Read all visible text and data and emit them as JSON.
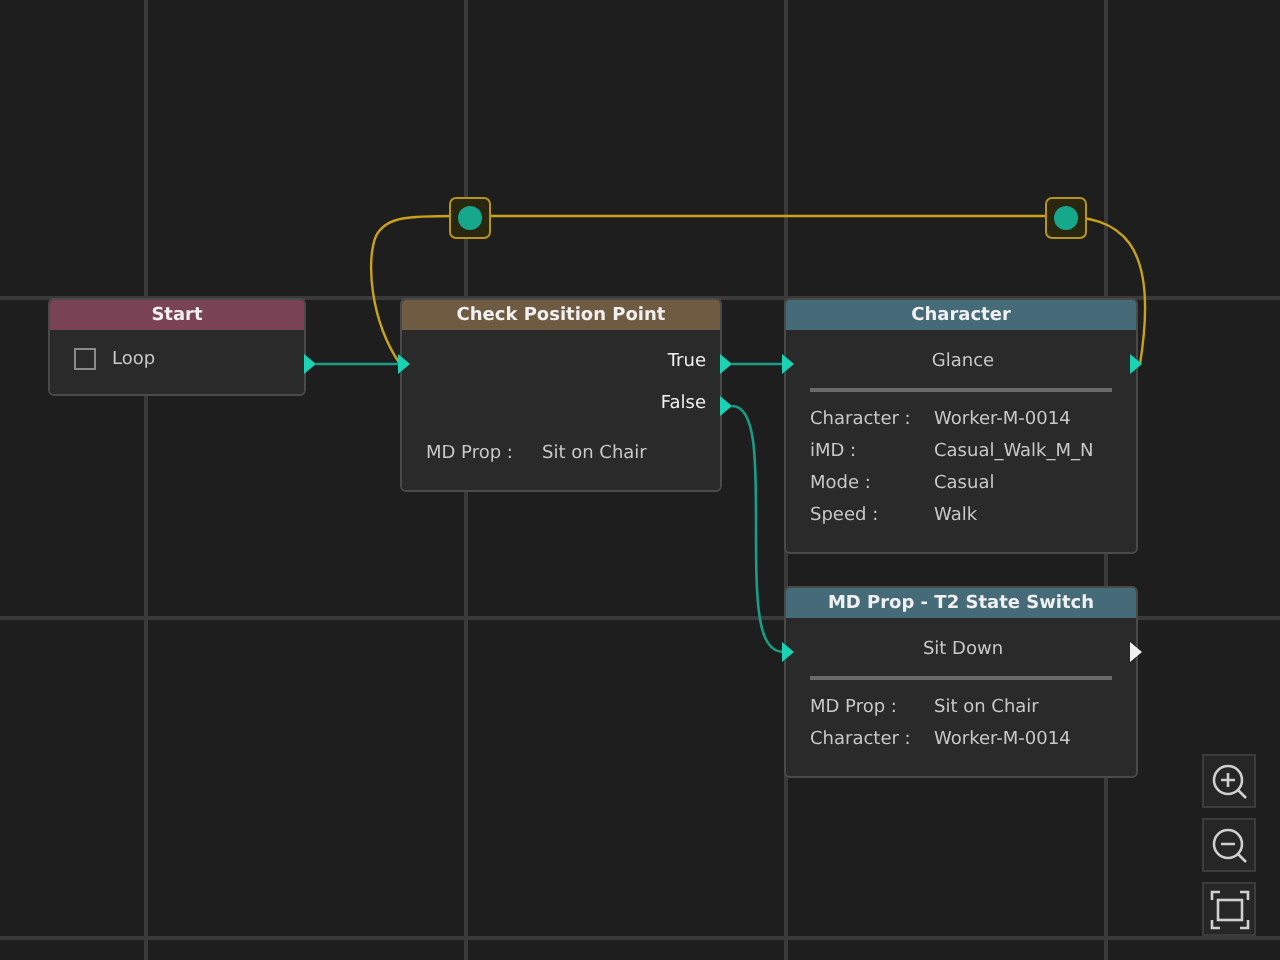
{
  "nodes": [
    {
      "kind": "start",
      "title": "Start",
      "color": "#7a4355",
      "checkbox": {
        "label": "Loop",
        "checked": false
      }
    },
    {
      "kind": "condition",
      "title": "Check Position Point",
      "color": "#6f5b42",
      "outputs": [
        "True",
        "False"
      ],
      "properties": [
        {
          "label": "MD Prop :",
          "value": "Sit on Chair"
        }
      ]
    },
    {
      "kind": "action",
      "title": "Character",
      "color": "#456b78",
      "action": "Glance",
      "output_connected": true,
      "properties": [
        {
          "label": "Character :",
          "value": "Worker-M-0014"
        },
        {
          "label": "iMD :",
          "value": "Casual_Walk_M_N"
        },
        {
          "label": "Mode :",
          "value": "Casual"
        },
        {
          "label": "Speed :",
          "value": "Walk"
        }
      ]
    },
    {
      "kind": "action",
      "title": "MD Prop - T2 State Switch",
      "color": "#456b78",
      "action": "Sit Down",
      "output_connected": false,
      "properties": [
        {
          "label": "MD Prop :",
          "value": "Sit on Chair"
        },
        {
          "label": "Character :",
          "value": "Worker-M-0014"
        }
      ]
    }
  ]
}
